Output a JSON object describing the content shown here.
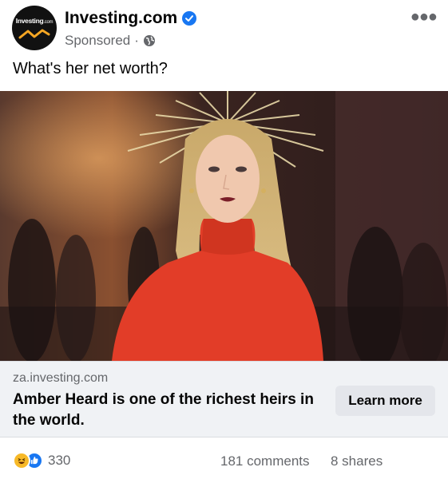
{
  "post": {
    "page_name": "Investing.com",
    "avatar_text": "Investing",
    "avatar_suffix": ".com",
    "sponsored_label": "Sponsored",
    "separator": "·",
    "caption": "What's her net worth?",
    "more_icon": "more-horizontal-icon"
  },
  "link": {
    "domain": "za.investing.com",
    "headline": "Amber Heard is one of the richest heirs in the world.",
    "cta_label": "Learn more"
  },
  "engagement": {
    "reaction_count": "330",
    "comments": "181 comments",
    "shares": "8 shares"
  },
  "colors": {
    "verified": "#1877f2",
    "meta_text": "#65676b",
    "card_bg": "#f0f2f5",
    "cta_bg": "#e4e6eb",
    "avatar_accent": "#f5a623"
  }
}
